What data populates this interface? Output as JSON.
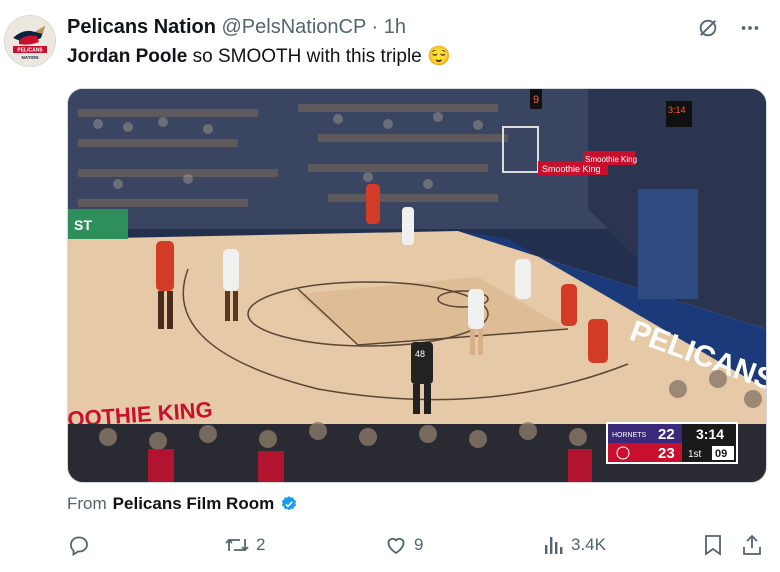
{
  "author": {
    "display_name": "Pelicans Nation",
    "handle": "@PelsNationCP",
    "separator": "·",
    "time": "1h",
    "avatar_text": "PELICANS NATION"
  },
  "tweet": {
    "text_bold": "Jordan Poole",
    "text_rest": " so SMOOTH with this triple ",
    "emoji": "😌"
  },
  "media": {
    "sideline_ad": "ST",
    "court_text_left": "OOTHIE KING",
    "court_text_right": "PELICANS",
    "baseline_sign": "Smoothie King",
    "stanchion_sign": "Smoothie King",
    "shot_clock": "9",
    "small_clock": "3:14",
    "ref_number": "48",
    "scoreboard": {
      "team1": "HORNETS",
      "team1_score": "22",
      "team2_score": "23",
      "game_clock": "3:14",
      "quarter": "1st",
      "shot_clock": "09",
      "team1_color": "#3b2a7a",
      "team2_color": "#c8102e"
    }
  },
  "source": {
    "prefix": "From",
    "account": "Pelicans Film Room",
    "verified_color": "#1d9bf0"
  },
  "actions": {
    "reply_count": "",
    "retweet_count": "2",
    "like_count": "9",
    "views_count": "3.4K"
  },
  "colors": {
    "text_primary": "#0f1419",
    "text_secondary": "#536471",
    "court_wood": "#e6c9a6",
    "court_paint": "#1b3a7a",
    "pelicans_red": "#c8102e"
  }
}
